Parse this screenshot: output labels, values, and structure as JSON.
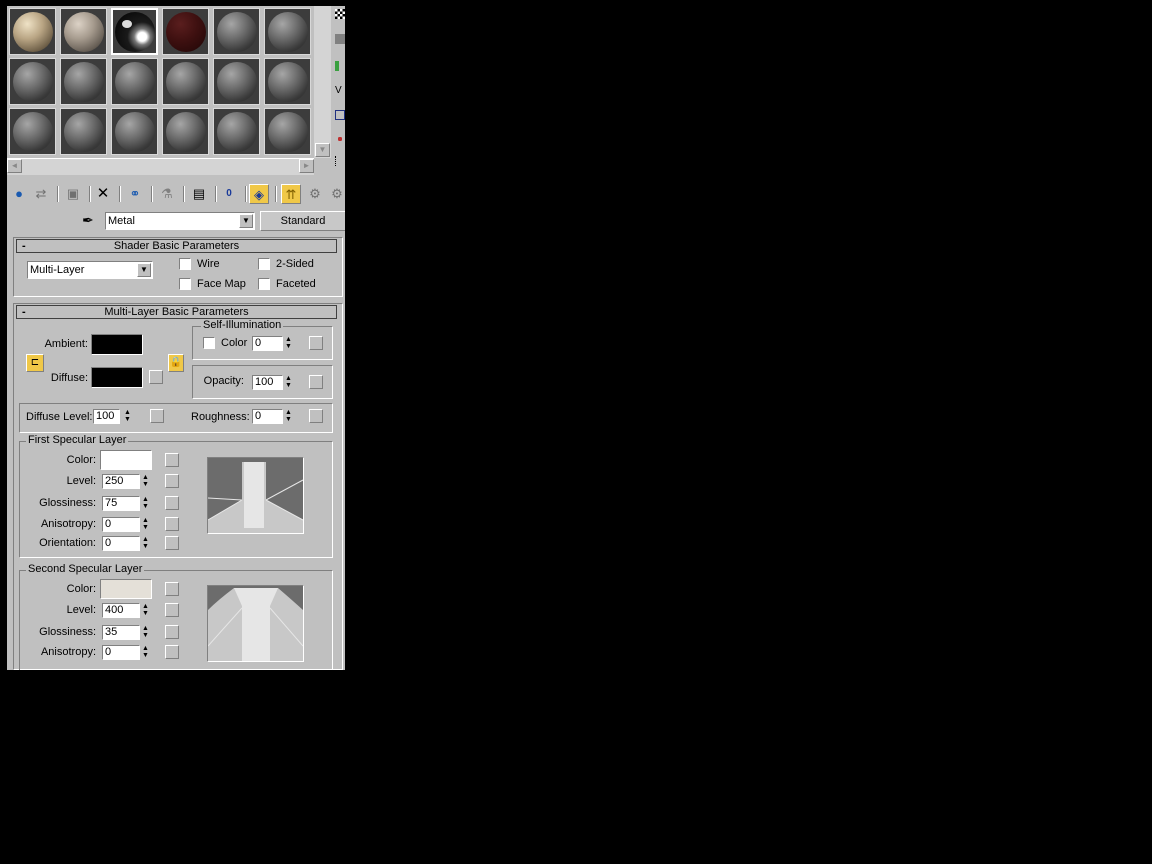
{
  "slots": [
    {
      "style": "tan"
    },
    {
      "style": "taupe"
    },
    {
      "style": "chrome",
      "selected": true
    },
    {
      "style": "wood"
    },
    {
      "style": "gray"
    },
    {
      "style": "gray"
    },
    {
      "style": "gray"
    },
    {
      "style": "gray"
    },
    {
      "style": "gray"
    },
    {
      "style": "gray"
    },
    {
      "style": "gray"
    },
    {
      "style": "gray"
    },
    {
      "style": "gray"
    },
    {
      "style": "gray"
    },
    {
      "style": "gray"
    },
    {
      "style": "gray"
    },
    {
      "style": "gray"
    },
    {
      "style": "gray"
    }
  ],
  "toolbar": {
    "icons": [
      "get-material-icon",
      "put-to-scene-icon",
      "assign-to-selection-icon",
      "reset-map-icon",
      "make-unique-icon",
      "put-to-library-icon",
      "material-effects-channel-icon",
      "show-map-in-viewport-icon",
      "show-end-result-icon",
      "go-to-parent-icon",
      "go-forward-to-sibling-icon"
    ],
    "active_index": [
      7,
      8
    ]
  },
  "material": {
    "name": "Metal",
    "type_button": "Standard"
  },
  "shader_basic": {
    "title": "Shader Basic Parameters",
    "collapse": "-",
    "shader": "Multi-Layer",
    "wire": "Wire",
    "two_sided": "2-Sided",
    "face_map": "Face Map",
    "faceted": "Faceted"
  },
  "multilayer": {
    "title": "Multi-Layer Basic Parameters",
    "collapse": "-",
    "ambient_label": "Ambient:",
    "diffuse_label": "Diffuse:",
    "ambient_color": "#000000",
    "diffuse_color": "#000000",
    "self_illum": {
      "title": "Self-Illumination",
      "color_label": "Color",
      "value": "0"
    },
    "opacity_label": "Opacity:",
    "opacity": "100",
    "diffuse_level_label": "Diffuse Level:",
    "diffuse_level": "100",
    "roughness_label": "Roughness:",
    "roughness": "0"
  },
  "first_specular": {
    "title": "First Specular Layer",
    "color_label": "Color:",
    "color": "#ffffff",
    "level_label": "Level:",
    "level": "250",
    "glossiness_label": "Glossiness:",
    "glossiness": "75",
    "anisotropy_label": "Anisotropy:",
    "anisotropy": "0",
    "orientation_label": "Orientation:",
    "orientation": "0"
  },
  "second_specular": {
    "title": "Second Specular Layer",
    "color_label": "Color:",
    "color": "#e4e0d8",
    "level_label": "Level:",
    "level": "400",
    "glossiness_label": "Glossiness:",
    "glossiness": "35",
    "anisotropy_label": "Anisotropy:",
    "anisotropy": "0"
  }
}
